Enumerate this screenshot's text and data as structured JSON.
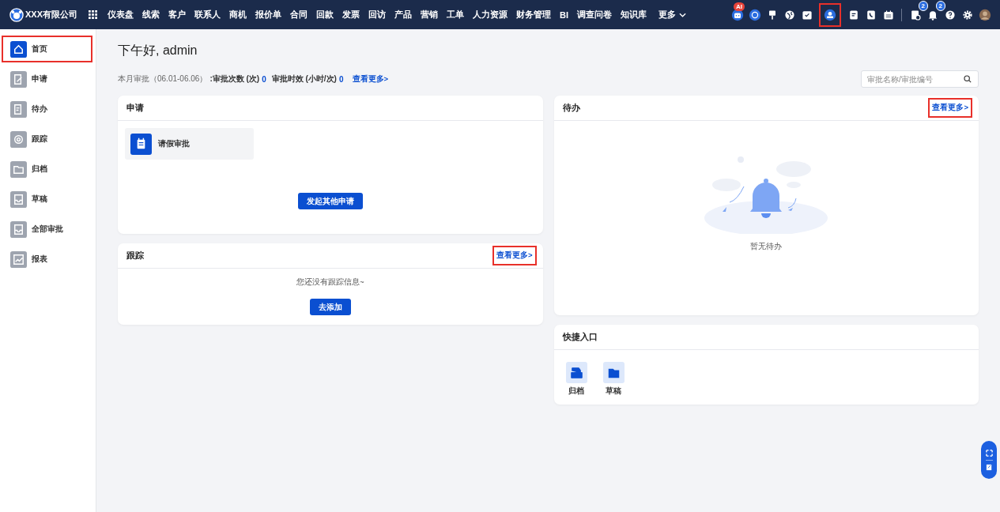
{
  "topbar": {
    "brand": "XXX有限公司",
    "nav": [
      "仪表盘",
      "线索",
      "客户",
      "联系人",
      "商机",
      "报价单",
      "合同",
      "回款",
      "发票",
      "回访",
      "产品",
      "营销",
      "工单",
      "人力资源",
      "财务管理",
      "BI",
      "调查问卷",
      "知识库"
    ],
    "more": "更多",
    "icons": [
      {
        "kind": "robot",
        "badge": "AI"
      },
      {
        "kind": "chat"
      },
      {
        "kind": "brush"
      },
      {
        "kind": "globe"
      },
      {
        "kind": "check"
      },
      {
        "kind": "user",
        "highlighted": true
      },
      {
        "kind": "doc"
      },
      {
        "kind": "phone"
      },
      {
        "kind": "calendar"
      },
      {
        "kind": "divider"
      },
      {
        "kind": "report",
        "badge": "2"
      },
      {
        "kind": "bell",
        "badge": "2"
      },
      {
        "kind": "help"
      },
      {
        "kind": "gear"
      },
      {
        "kind": "avatar"
      }
    ]
  },
  "sidebar": {
    "items": [
      {
        "label": "首页",
        "kind": "home",
        "selected": true,
        "highlighted": true
      },
      {
        "label": "申请",
        "kind": "edit",
        "selected": false,
        "highlighted": false
      },
      {
        "label": "待办",
        "kind": "todo",
        "selected": false,
        "highlighted": false
      },
      {
        "label": "跟踪",
        "kind": "target",
        "selected": false,
        "highlighted": false
      },
      {
        "label": "归档",
        "kind": "folder",
        "selected": false,
        "highlighted": false
      },
      {
        "label": "草稿",
        "kind": "tray",
        "selected": false,
        "highlighted": false
      },
      {
        "label": "全部审批",
        "kind": "tray",
        "selected": false,
        "highlighted": false
      },
      {
        "label": "报表",
        "kind": "chart",
        "selected": false,
        "highlighted": false
      }
    ]
  },
  "greeting": "下午好, admin",
  "stats": {
    "label": "本月审批（06.01-06.06）",
    "items": [
      {
        "label": ":审批次数 (次)",
        "value": "0"
      },
      {
        "label": "审批时效 (小时/次)",
        "value": "0"
      }
    ],
    "more": "查看更多>"
  },
  "search": {
    "placeholder": "审批名称/审批编号"
  },
  "apply_card": {
    "title": "申请",
    "items": [
      {
        "label": "请假审批"
      }
    ],
    "button": "发起其他申请"
  },
  "track_card": {
    "title": "跟踪",
    "more": {
      "label": "查看更多>",
      "highlighted": true
    },
    "empty": "您还没有跟踪信息~",
    "button": "去添加"
  },
  "todo_card": {
    "title": "待办",
    "more": {
      "label": "查看更多>",
      "highlighted": true
    },
    "empty": "暂无待办"
  },
  "shortcuts": {
    "title": "快捷入口",
    "items": [
      {
        "label": "归档",
        "kind": "archive"
      },
      {
        "label": "草稿",
        "kind": "folder"
      }
    ]
  }
}
